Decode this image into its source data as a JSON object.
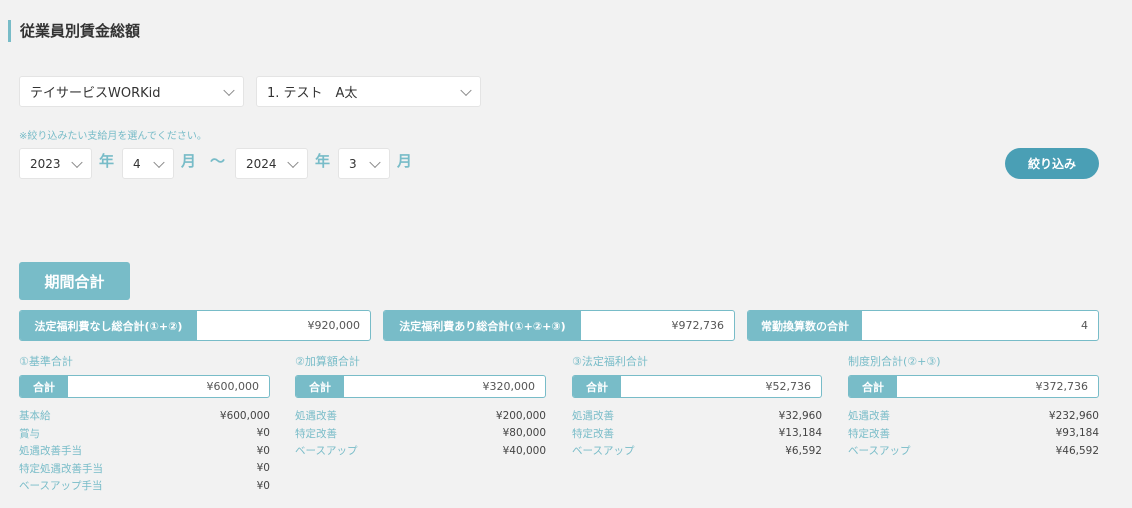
{
  "page": {
    "title": "従業員別賃金総額"
  },
  "filters": {
    "company": "テイサービスWORKid",
    "employee": "1. テスト　A太",
    "note": "※絞り込みたい支給月を選んでください。",
    "from_year": "2023",
    "from_month": "4",
    "to_year": "2024",
    "to_month": "3",
    "year_unit": "年",
    "month_unit": "月",
    "range_sep": "〜",
    "button": "絞り込み"
  },
  "period": {
    "heading": "期間合計",
    "summaries": [
      {
        "label": "法定福利費なし総合計(①+②)",
        "value": "¥920,000"
      },
      {
        "label": "法定福利費あり総合計(①+②+③)",
        "value": "¥972,736"
      },
      {
        "label": "常勤換算数の合計",
        "value": "4"
      }
    ],
    "total_label": "合計",
    "columns": [
      {
        "title": "①基準合計",
        "total": "¥600,000",
        "rows": [
          {
            "label": "基本給",
            "value": "¥600,000"
          },
          {
            "label": "賞与",
            "value": "¥0"
          },
          {
            "label": "処遇改善手当",
            "value": "¥0"
          },
          {
            "label": "特定処遇改善手当",
            "value": "¥0"
          },
          {
            "label": "ベースアップ手当",
            "value": "¥0"
          }
        ]
      },
      {
        "title": "②加算額合計",
        "total": "¥320,000",
        "rows": [
          {
            "label": "処遇改善",
            "value": "¥200,000"
          },
          {
            "label": "特定改善",
            "value": "¥80,000"
          },
          {
            "label": "ベースアップ",
            "value": "¥40,000"
          }
        ]
      },
      {
        "title": "③法定福利合計",
        "total": "¥52,736",
        "rows": [
          {
            "label": "処遇改善",
            "value": "¥32,960"
          },
          {
            "label": "特定改善",
            "value": "¥13,184"
          },
          {
            "label": "ベースアップ",
            "value": "¥6,592"
          }
        ]
      },
      {
        "title": "制度別合計(②+③)",
        "total": "¥372,736",
        "rows": [
          {
            "label": "処遇改善",
            "value": "¥232,960"
          },
          {
            "label": "特定改善",
            "value": "¥93,184"
          },
          {
            "label": "ベースアップ",
            "value": "¥46,592"
          }
        ]
      }
    ]
  }
}
